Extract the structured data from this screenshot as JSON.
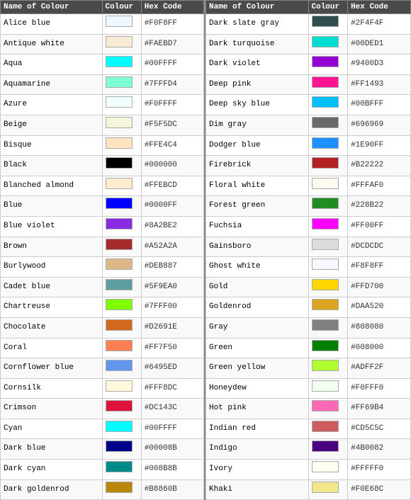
{
  "leftTable": {
    "headers": [
      "Name of Colour",
      "Colour",
      "Hex Code"
    ],
    "rows": [
      {
        "name": "Alice blue",
        "hex": "#F0F8FF",
        "color": "#F0F8FF"
      },
      {
        "name": "Antique white",
        "hex": "#FAEBD7",
        "color": "#FAEBD7"
      },
      {
        "name": "Aqua",
        "hex": "#00FFFF",
        "color": "#00FFFF"
      },
      {
        "name": "Aquamarine",
        "hex": "#7FFFD4",
        "color": "#7FFFD4"
      },
      {
        "name": "Azure",
        "hex": "#F0FFFF",
        "color": "#F0FFFF"
      },
      {
        "name": "Beige",
        "hex": "#F5F5DC",
        "color": "#F5F5DC"
      },
      {
        "name": "Bisque",
        "hex": "#FFE4C4",
        "color": "#FFE4C4"
      },
      {
        "name": "Black",
        "hex": "#000000",
        "color": "#000000"
      },
      {
        "name": "Blanched almond",
        "hex": "#FFEBCD",
        "color": "#FFEBCD"
      },
      {
        "name": "Blue",
        "hex": "#0000FF",
        "color": "#0000FF"
      },
      {
        "name": "Blue violet",
        "hex": "#8A2BE2",
        "color": "#8A2BE2"
      },
      {
        "name": "Brown",
        "hex": "#A52A2A",
        "color": "#A52A2A"
      },
      {
        "name": "Burlywood",
        "hex": "#DEB887",
        "color": "#DEB887"
      },
      {
        "name": "Cadet blue",
        "hex": "#5F9EA0",
        "color": "#5F9EA0"
      },
      {
        "name": "Chartreuse",
        "hex": "#7FFF00",
        "color": "#7FFF00"
      },
      {
        "name": "Chocolate",
        "hex": "#D2691E",
        "color": "#D2691E"
      },
      {
        "name": "Coral",
        "hex": "#FF7F50",
        "color": "#FF7F50"
      },
      {
        "name": "Cornflower blue",
        "hex": "#6495ED",
        "color": "#6495ED"
      },
      {
        "name": "Cornsilk",
        "hex": "#FFF8DC",
        "color": "#FFF8DC"
      },
      {
        "name": "Crimson",
        "hex": "#DC143C",
        "color": "#DC143C"
      },
      {
        "name": "Cyan",
        "hex": "#00FFFF",
        "color": "#00FFFF"
      },
      {
        "name": "Dark blue",
        "hex": "#00008B",
        "color": "#00008B"
      },
      {
        "name": "Dark cyan",
        "hex": "#008B8B",
        "color": "#008B8B"
      },
      {
        "name": "Dark goldenrod",
        "hex": "#B8860B",
        "color": "#B8860B"
      }
    ]
  },
  "rightTable": {
    "headers": [
      "Name of Colour",
      "Colour",
      "Hex Code"
    ],
    "rows": [
      {
        "name": "Dark slate gray",
        "hex": "#2F4F4F",
        "color": "#2F4F4F"
      },
      {
        "name": "Dark turquoise",
        "hex": "#00DED1",
        "color": "#00DED1"
      },
      {
        "name": "Dark violet",
        "hex": "#9400D3",
        "color": "#9400D3"
      },
      {
        "name": "Deep pink",
        "hex": "#FF1493",
        "color": "#FF1493"
      },
      {
        "name": "Deep sky blue",
        "hex": "#00BFFF",
        "color": "#00BFFF"
      },
      {
        "name": "Dim gray",
        "hex": "#696969",
        "color": "#696969"
      },
      {
        "name": "Dodger blue",
        "hex": "#1E90FF",
        "color": "#1E90FF"
      },
      {
        "name": "Firebrick",
        "hex": "#B22222",
        "color": "#B22222"
      },
      {
        "name": "Floral white",
        "hex": "#FFFAF0",
        "color": "#FFFAF0"
      },
      {
        "name": "Forest green",
        "hex": "#228B22",
        "color": "#228B22"
      },
      {
        "name": "Fuchsia",
        "hex": "#FF00FF",
        "color": "#FF00FF"
      },
      {
        "name": "Gainsboro",
        "hex": "#DCDCDC",
        "color": "#DCDCDC"
      },
      {
        "name": "Ghost white",
        "hex": "#F8F8FF",
        "color": "#F8F8FF"
      },
      {
        "name": "Gold",
        "hex": "#FFD700",
        "color": "#FFD700"
      },
      {
        "name": "Goldenrod",
        "hex": "#DAA520",
        "color": "#DAA520"
      },
      {
        "name": "Gray",
        "hex": "#808080",
        "color": "#808080"
      },
      {
        "name": "Green",
        "hex": "#008000",
        "color": "#008000"
      },
      {
        "name": "Green yellow",
        "hex": "#ADFF2F",
        "color": "#ADFF2F"
      },
      {
        "name": "Honeydew",
        "hex": "#F0FFF0",
        "color": "#F0FFF0"
      },
      {
        "name": "Hot pink",
        "hex": "#FF69B4",
        "color": "#FF69B4"
      },
      {
        "name": "Indian red",
        "hex": "#CD5C5C",
        "color": "#CD5C5C"
      },
      {
        "name": "Indigo",
        "hex": "#4B0082",
        "color": "#4B0082"
      },
      {
        "name": "Ivory",
        "hex": "#FFFFF0",
        "color": "#FFFFF0"
      },
      {
        "name": "Khaki",
        "hex": "#F0E68C",
        "color": "#F0E68C"
      }
    ]
  }
}
